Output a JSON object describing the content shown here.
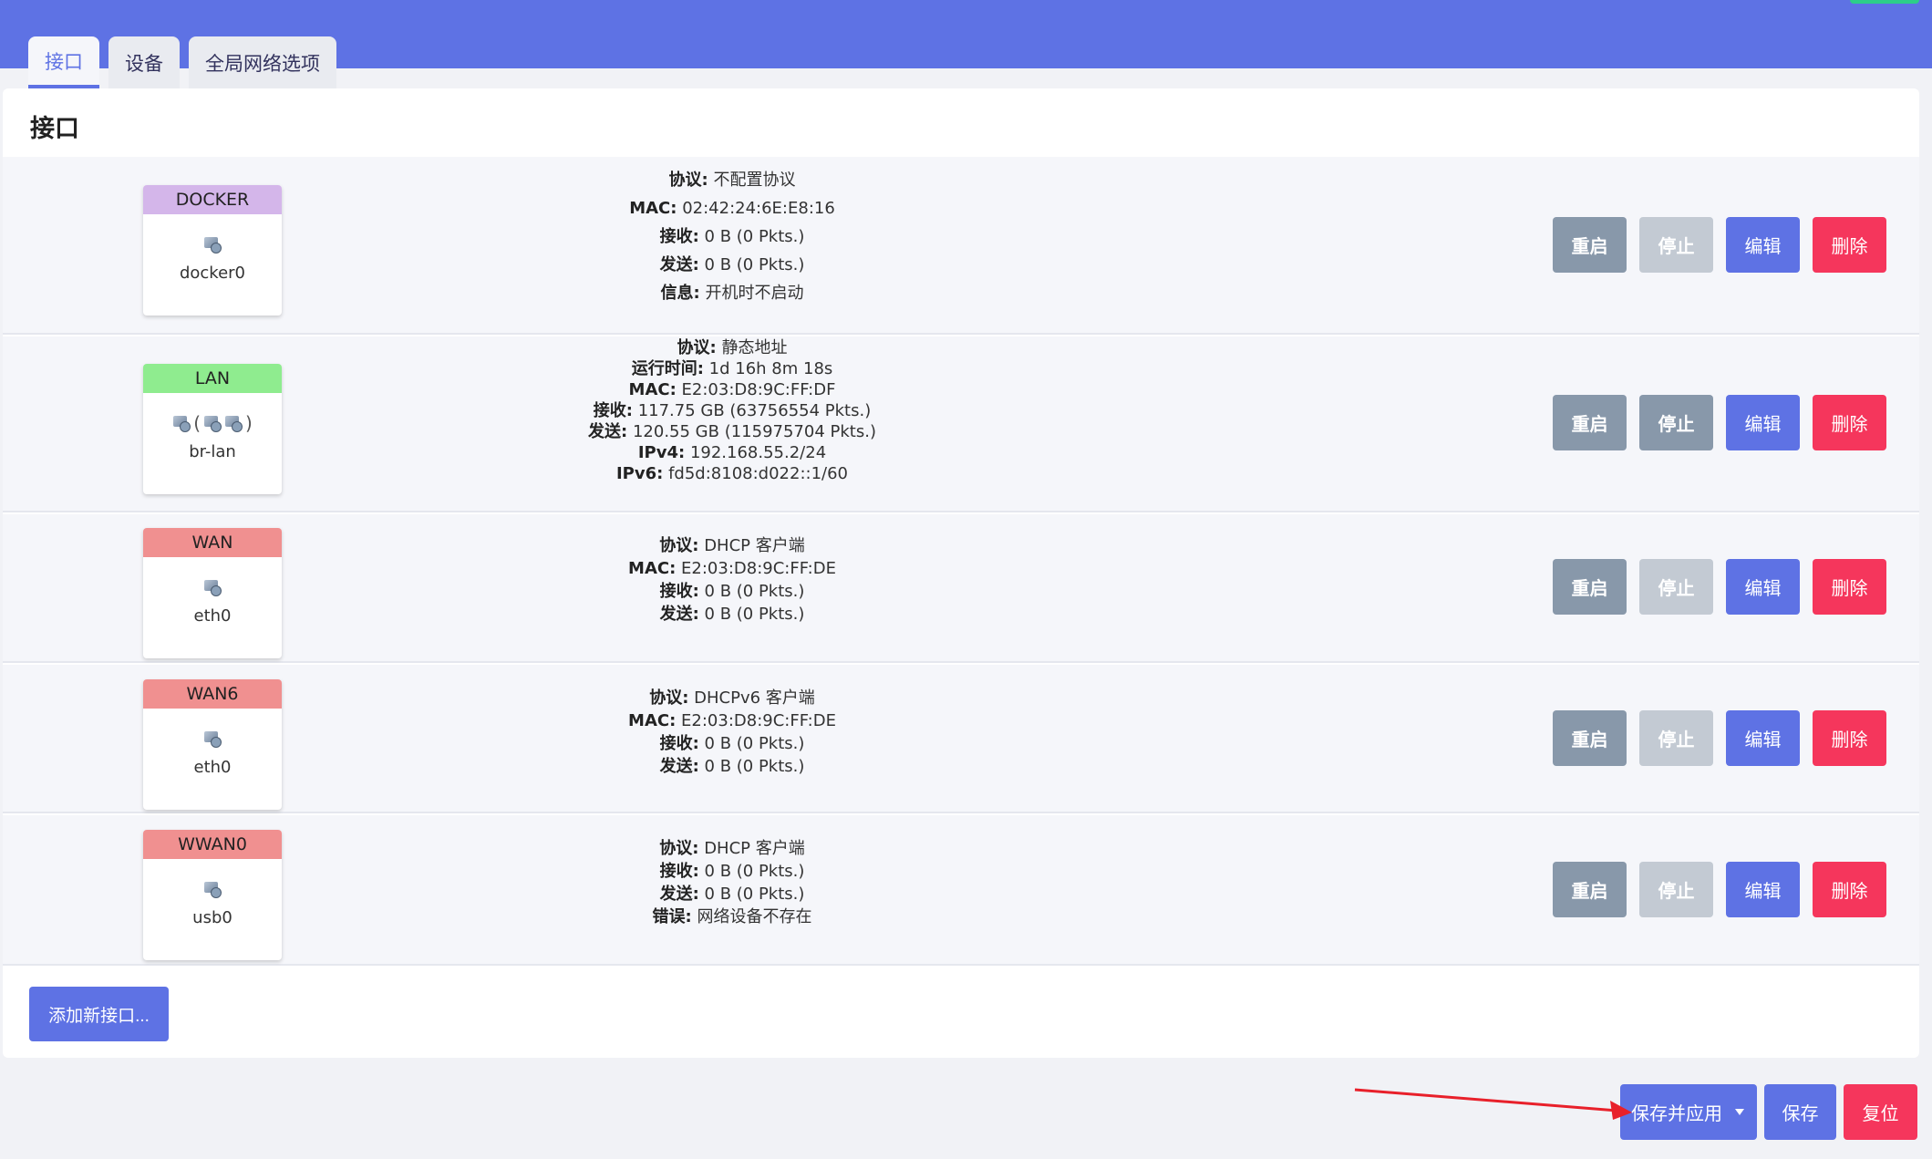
{
  "tabs": [
    {
      "label": "接口"
    },
    {
      "label": "设备"
    },
    {
      "label": "全局网络选项"
    }
  ],
  "panel": {
    "title": "接口"
  },
  "interfaces": [
    {
      "name": "DOCKER",
      "color": "#d4b6ea",
      "device": "docker0",
      "icon": "network-port-icon",
      "info": [
        {
          "k": "协议:",
          "v": "不配置协议"
        },
        {
          "k": "MAC:",
          "v": "02:42:24:6E:E8:16"
        },
        {
          "k": "接收:",
          "v": "0 B (0 Pkts.)"
        },
        {
          "k": "发送:",
          "v": "0 B (0 Pkts.)"
        },
        {
          "k": "信息:",
          "v": "开机时不启动"
        }
      ],
      "stop_disabled": true
    },
    {
      "name": "LAN",
      "color": "#8fec8f",
      "device": "br-lan",
      "icon": "bridge-icon",
      "info": [
        {
          "k": "协议:",
          "v": "静态地址"
        },
        {
          "k": "运行时间:",
          "v": "1d 16h 8m 18s"
        },
        {
          "k": "MAC:",
          "v": "E2:03:D8:9C:FF:DF"
        },
        {
          "k": "接收:",
          "v": "117.75 GB (63756554 Pkts.)"
        },
        {
          "k": "发送:",
          "v": "120.55 GB (115975704 Pkts.)"
        },
        {
          "k": "IPv4:",
          "v": "192.168.55.2/24"
        },
        {
          "k": "IPv6:",
          "v": "fd5d:8108:d022::1/60"
        }
      ],
      "stop_disabled": false
    },
    {
      "name": "WAN",
      "color": "#f09090",
      "device": "eth0",
      "icon": "ethernet-icon",
      "info": [
        {
          "k": "协议:",
          "v": "DHCP 客户端"
        },
        {
          "k": "MAC:",
          "v": "E2:03:D8:9C:FF:DE"
        },
        {
          "k": "接收:",
          "v": "0 B (0 Pkts.)"
        },
        {
          "k": "发送:",
          "v": "0 B (0 Pkts.)"
        }
      ],
      "stop_disabled": true
    },
    {
      "name": "WAN6",
      "color": "#f09090",
      "device": "eth0",
      "icon": "ethernet-icon",
      "info": [
        {
          "k": "协议:",
          "v": "DHCPv6 客户端"
        },
        {
          "k": "MAC:",
          "v": "E2:03:D8:9C:FF:DE"
        },
        {
          "k": "接收:",
          "v": "0 B (0 Pkts.)"
        },
        {
          "k": "发送:",
          "v": "0 B (0 Pkts.)"
        }
      ],
      "stop_disabled": true
    },
    {
      "name": "WWAN0",
      "color": "#f09090",
      "device": "usb0",
      "icon": "ethernet-icon",
      "info": [
        {
          "k": "协议:",
          "v": "DHCP 客户端"
        },
        {
          "k": "接收:",
          "v": "0 B (0 Pkts.)"
        },
        {
          "k": "发送:",
          "v": "0 B (0 Pkts.)"
        },
        {
          "k": "错误:",
          "v": "网络设备不存在"
        }
      ],
      "stop_disabled": true
    }
  ],
  "row_buttons": {
    "restart": "重启",
    "stop": "停止",
    "edit": "编辑",
    "delete": "删除"
  },
  "add_button": "添加新接口...",
  "footer": {
    "apply": "保存并应用",
    "save": "保存",
    "reset": "复位"
  },
  "colors": {
    "accent": "#5e72e4",
    "danger": "#f5365c",
    "muted": "#8898aa",
    "annotation": "#e8202a"
  }
}
